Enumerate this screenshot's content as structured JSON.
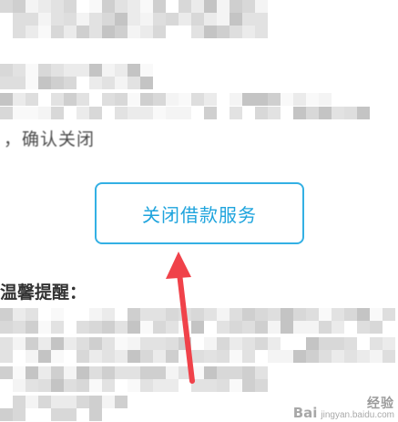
{
  "partial_text_line": "，确认关闭",
  "close_button": {
    "label": "关闭借款服务",
    "border_color": "#33b0e4",
    "text_color": "#1fa4dd"
  },
  "reminder_heading": "温馨提醒：",
  "annotation_arrow": {
    "color": "#f0424a"
  },
  "watermark": {
    "logo": "Bai",
    "brand": "经验",
    "url": "jingyan.baidu.com"
  }
}
